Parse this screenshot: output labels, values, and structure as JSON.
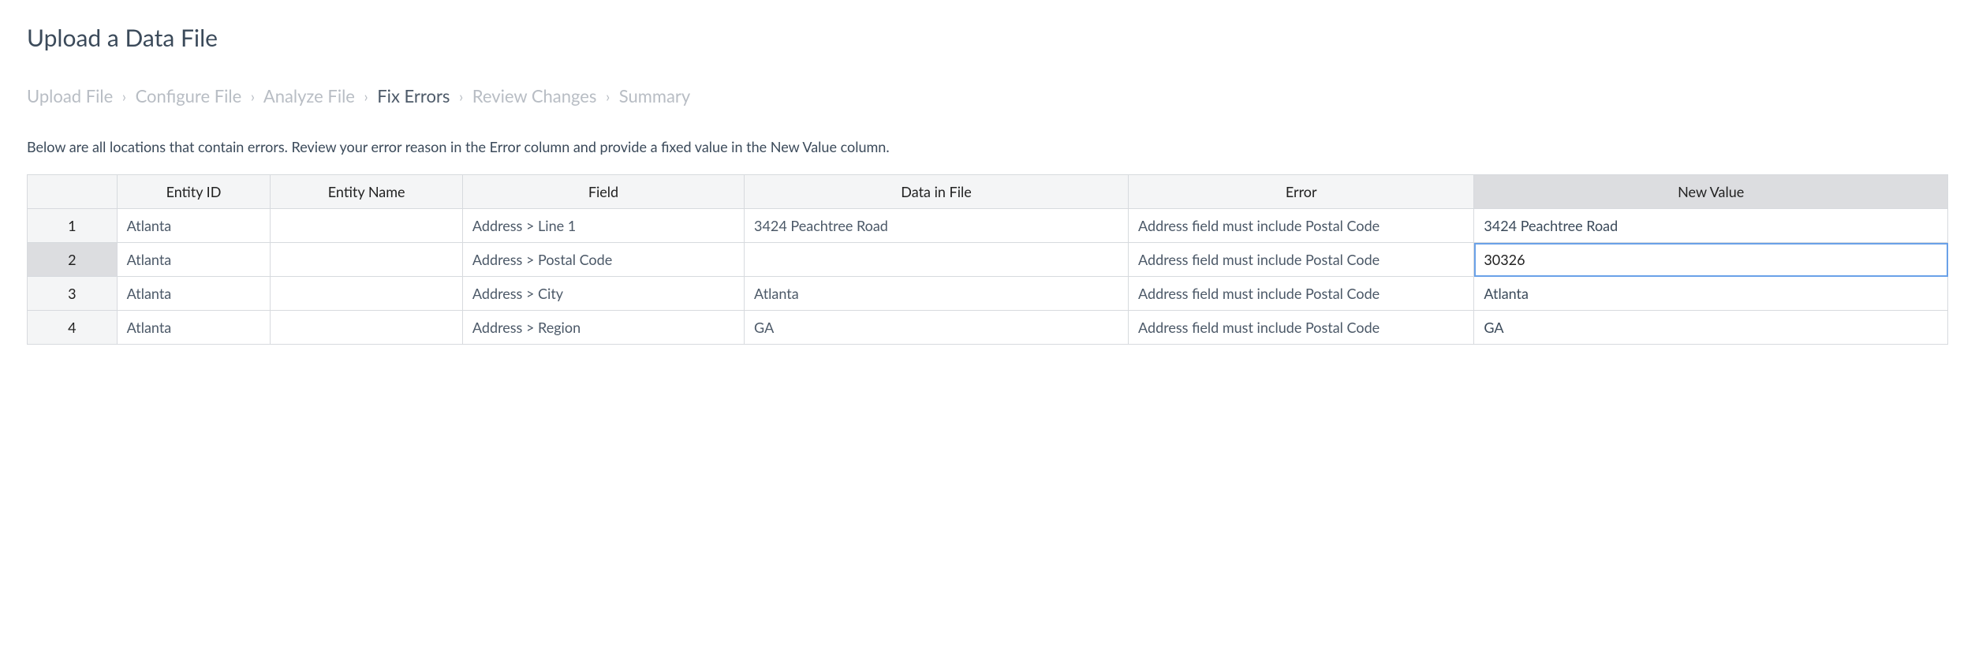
{
  "page": {
    "title": "Upload a Data File",
    "instructions": "Below are all locations that contain errors. Review your error reason in the Error column and provide a fixed value in the New Value column."
  },
  "breadcrumb": {
    "sep": "›",
    "steps": [
      {
        "label": "Upload File",
        "active": false
      },
      {
        "label": "Configure File",
        "active": false
      },
      {
        "label": "Analyze File",
        "active": false
      },
      {
        "label": "Fix Errors",
        "active": true
      },
      {
        "label": "Review Changes",
        "active": false
      },
      {
        "label": "Summary",
        "active": false
      }
    ]
  },
  "table": {
    "headers": {
      "entity_id": "Entity ID",
      "entity_name": "Entity Name",
      "field": "Field",
      "data": "Data in File",
      "error": "Error",
      "new_value": "New Value"
    },
    "rows": [
      {
        "num": "1",
        "entity_id": "Atlanta",
        "entity_name": "",
        "field": "Address > Line 1",
        "data": "3424 Peachtree Road",
        "error": "Address field must include Postal Code",
        "new_value": "3424 Peachtree Road",
        "active": false
      },
      {
        "num": "2",
        "entity_id": "Atlanta",
        "entity_name": "",
        "field": "Address > Postal Code",
        "data": "",
        "error": "Address field must include Postal Code",
        "new_value": "30326",
        "active": true
      },
      {
        "num": "3",
        "entity_id": "Atlanta",
        "entity_name": "",
        "field": "Address > City",
        "data": "Atlanta",
        "error": "Address field must include Postal Code",
        "new_value": "Atlanta",
        "active": false
      },
      {
        "num": "4",
        "entity_id": "Atlanta",
        "entity_name": "",
        "field": "Address > Region",
        "data": "GA",
        "error": "Address field must include Postal Code",
        "new_value": "GA",
        "active": false
      }
    ]
  }
}
